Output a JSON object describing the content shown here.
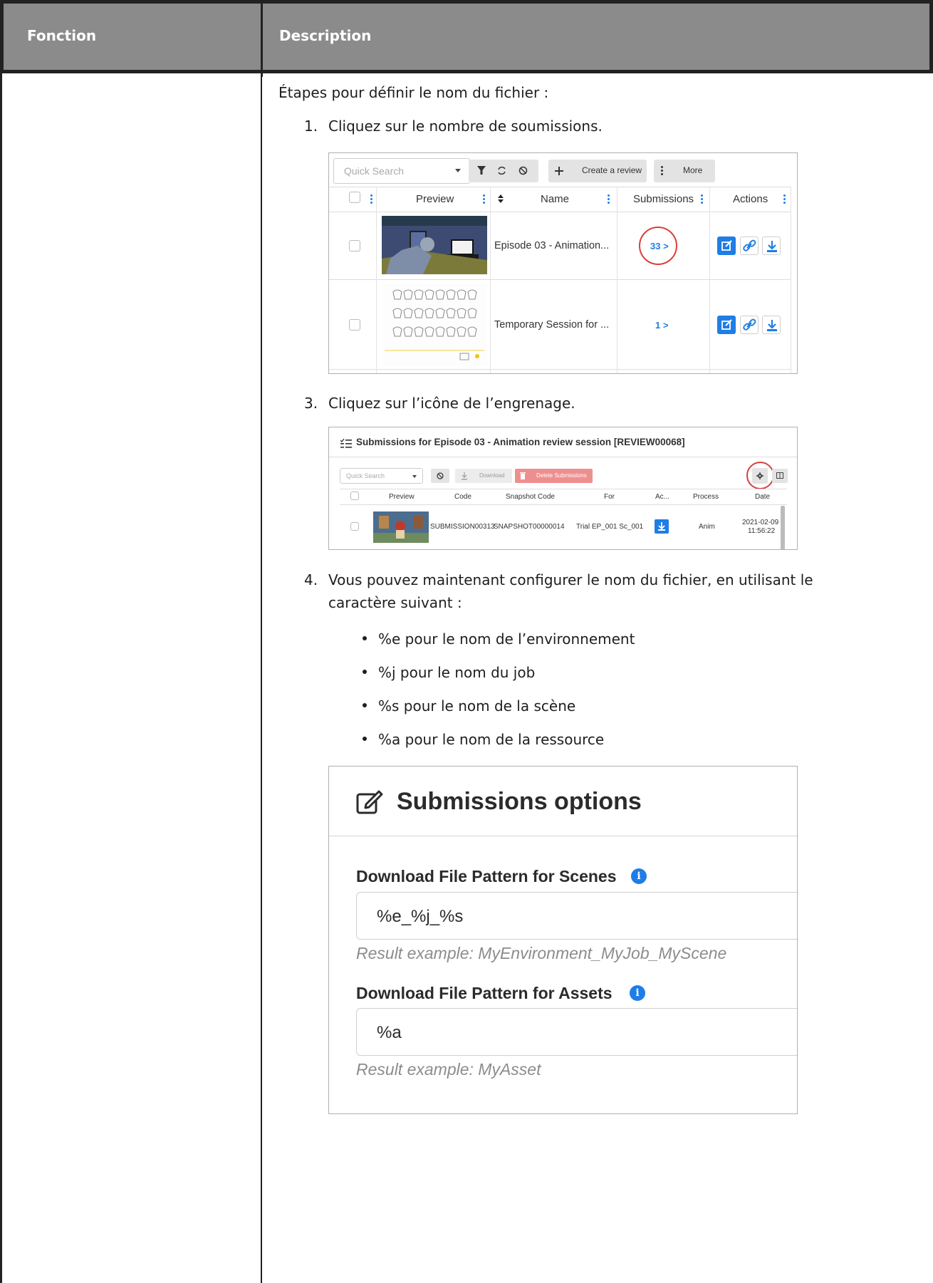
{
  "table": {
    "headers": [
      "Fonction",
      "Description"
    ]
  },
  "intro": "Étapes pour définir le nom du fichier :",
  "steps": [
    {
      "number": "1.",
      "text": "Cliquez sur le nombre de soumissions."
    },
    {
      "number": "3.",
      "text": "Cliquez sur l’icône de l’engrenage."
    },
    {
      "number": "4.",
      "text_line1": "Vous pouvez maintenant configurer le nom du fichier, en utilisant le",
      "text_line2": "caractère suivant :"
    }
  ],
  "bullets": [
    "%e pour le nom de l’environnement",
    "%j pour le nom du job",
    "%s pour le nom de la scène",
    "%a pour le nom de la ressource"
  ],
  "screenshot1": {
    "search_placeholder": "Quick Search",
    "create_label": "Create a review",
    "more_label": "More",
    "columns": [
      "Preview",
      "Name",
      "Submissions",
      "Actions"
    ],
    "rows": [
      {
        "name": "Episode 03 - Animation...",
        "submissions": "33 >"
      },
      {
        "name": "Temporary Session for ...",
        "submissions": "1 >"
      }
    ]
  },
  "screenshot3": {
    "title": "Submissions for Episode 03 - Animation review session [REVIEW00068]",
    "search_placeholder": "Quick Search",
    "download_label": "Download",
    "delete_label": "Delete Submissions",
    "columns": [
      "Preview",
      "Code",
      "Snapshot Code",
      "For",
      "Ac...",
      "Process",
      "Date"
    ],
    "row": {
      "code": "SUBMISSION00313",
      "snapshot": "SNAPSHOT00000014",
      "for": "Trial EP_001 Sc_001",
      "process": "Anim",
      "date_line1": "2021-02-09",
      "date_line2": "11:56:22"
    }
  },
  "options": {
    "title": "Submissions options",
    "scenes_label": "Download File Pattern for Scenes",
    "scenes_value": "%e_%j_%s",
    "scenes_help": "Result example: MyEnvironment_MyJob_MyScene",
    "assets_label": "Download File Pattern for Assets",
    "assets_value": "%a",
    "assets_help": "Result example: MyAsset"
  },
  "colors": {
    "header_bg": "#8b8b8b",
    "accent_blue": "#1f7de6",
    "highlight_red": "#d9403a"
  }
}
